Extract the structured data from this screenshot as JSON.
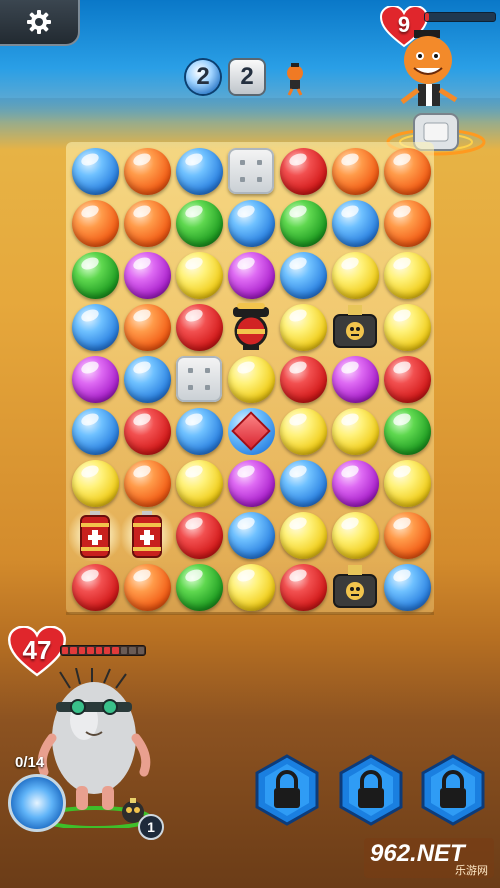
{
  "hud": {
    "settings_icon": "gear-icon",
    "round": {
      "current": "2",
      "total": "2"
    }
  },
  "enemy": {
    "hp": "9",
    "hp_fraction": 0.06,
    "colors": {
      "heart": "#e0262c",
      "bar_fill": "#e03232"
    }
  },
  "player": {
    "hp": "47",
    "hp_segments_filled": 7,
    "hp_segments_total": 10,
    "charge": "0/14",
    "pet_count": "1"
  },
  "board": {
    "rows": [
      [
        "blue",
        "orange",
        "blue",
        "block",
        "red",
        "orange",
        "orange"
      ],
      [
        "orange",
        "orange",
        "green",
        "blue",
        "green",
        "blue",
        "orange"
      ],
      [
        "green",
        "purple",
        "yellow",
        "purple",
        "blue",
        "yellow",
        "yellow"
      ],
      [
        "blue",
        "orange",
        "red",
        "bomb-robot",
        "yellow",
        "bomb-box",
        "yellow"
      ],
      [
        "purple",
        "blue",
        "block",
        "yellow",
        "red",
        "purple",
        "red"
      ],
      [
        "blue",
        "red",
        "blue",
        "crystal",
        "yellow",
        "yellow",
        "green"
      ],
      [
        "yellow",
        "orange",
        "yellow",
        "purple",
        "blue",
        "purple",
        "yellow"
      ],
      [
        "battery",
        "battery",
        "red",
        "blue",
        "yellow",
        "yellow",
        "orange"
      ],
      [
        "red",
        "orange",
        "green",
        "yellow",
        "red",
        "bomb-box",
        "blue"
      ]
    ]
  },
  "abilities": [
    {
      "icon": "lock-icon",
      "locked": true
    },
    {
      "icon": "lock-icon",
      "locked": true
    },
    {
      "icon": "lock-icon",
      "locked": true
    }
  ],
  "watermark": {
    "main": "962.NET",
    "sub": "乐游网"
  }
}
